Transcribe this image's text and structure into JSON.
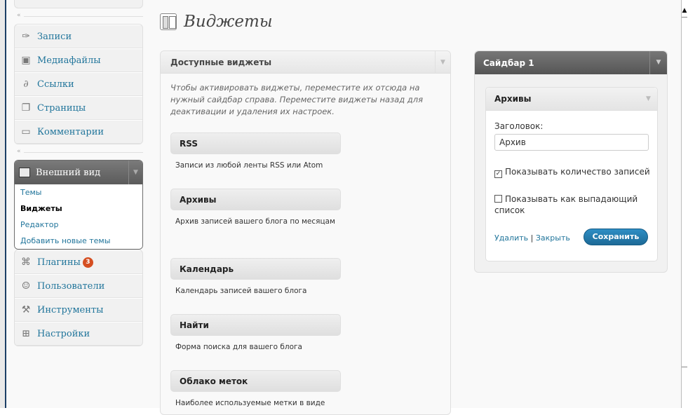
{
  "menu": {
    "items_top": [
      {
        "label": "Записи",
        "icon": "pushpin-icon"
      },
      {
        "label": "Медиафайлы",
        "icon": "media-icon"
      },
      {
        "label": "Ссылки",
        "icon": "link-icon"
      },
      {
        "label": "Страницы",
        "icon": "pages-icon"
      },
      {
        "label": "Комментарии",
        "icon": "comment-icon"
      }
    ],
    "appearance": {
      "label": "Внешний вид",
      "submenu": [
        "Темы",
        "Виджеты",
        "Редактор",
        "Добавить новые темы"
      ],
      "current": "Виджеты"
    },
    "items_bottom": [
      {
        "label": "Плагины",
        "icon": "plugin-icon",
        "badge": "3"
      },
      {
        "label": "Пользователи",
        "icon": "users-icon"
      },
      {
        "label": "Инструменты",
        "icon": "tools-icon"
      },
      {
        "label": "Настройки",
        "icon": "settings-icon"
      }
    ]
  },
  "page": {
    "title": "Виджеты"
  },
  "available": {
    "title": "Доступные виджеты",
    "description": "Чтобы активировать виджеты, переместите их отсюда на нужный сайдбар справа. Переместите виджеты назад для деактивации и удаления их настроек.",
    "widgets": [
      {
        "title": "RSS",
        "desc": "Записи из любой ленты RSS или Atom"
      },
      {
        "title": "Архивы",
        "desc": "Архив записей вашего блога по месяцам"
      },
      {
        "title": "Календарь",
        "desc": "Календарь записей вашего блога"
      },
      {
        "title": "Найти",
        "desc": "Форма поиска для вашего блога"
      },
      {
        "title": "Облако меток",
        "desc": "Наиболее используемые метки в виде"
      }
    ]
  },
  "sidebar": {
    "title": "Сайдбар 1",
    "widget": {
      "title": "Архивы",
      "field_label": "Заголовок:",
      "field_value": "Архив",
      "checkbox_count": {
        "label": "Показывать количество записей",
        "checked": true
      },
      "checkbox_dropdown": {
        "label": "Показывать как выпадающий список",
        "checked": false
      },
      "delete_label": "Удалить",
      "link_separator": "|",
      "close_label": "Закрыть",
      "save_label": "Сохранить"
    }
  },
  "colors": {
    "link": "#21759b",
    "badge": "#d54e21",
    "primary_button": "#21759b"
  }
}
